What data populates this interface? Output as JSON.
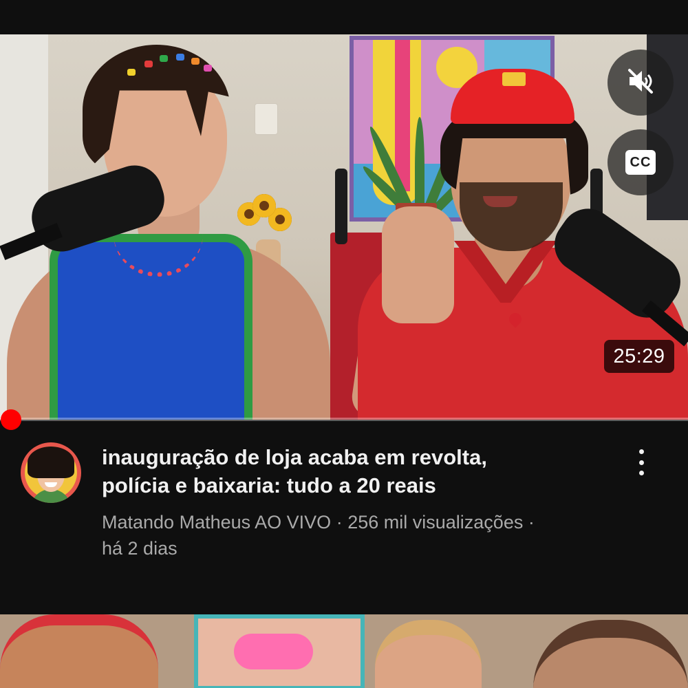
{
  "player": {
    "duration": "25:29",
    "progress_fraction": 0.0,
    "buttons": {
      "mute_icon": "volume-muted-icon",
      "cc_icon": "closed-captions-icon",
      "cc_label": "CC"
    }
  },
  "video": {
    "title_line1": "inauguração de loja acaba em revolta,",
    "title_line2": "polícia e baixaria: tudo a 20 reais",
    "channel": "Matando Matheus AO VIVO",
    "views": "256 mil visualizações",
    "age": "há 2 dias",
    "separator": "·"
  },
  "colors": {
    "background": "#0f0f0f",
    "progress": "#ff0000",
    "title": "#f1f1f1",
    "meta": "#aaaaaa"
  },
  "icons": {
    "more_actions": "more-vertical-icon",
    "avatar": "channel-avatar"
  }
}
